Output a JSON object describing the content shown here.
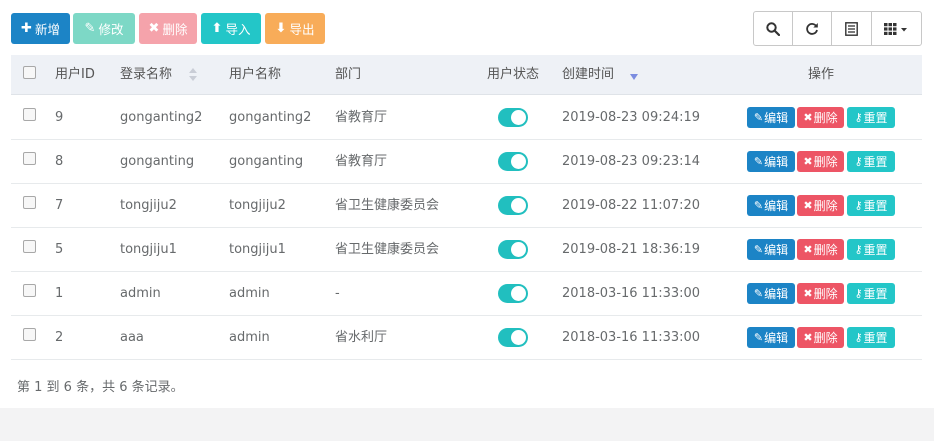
{
  "toolbar": {
    "add_label": "新增",
    "edit_label": "修改",
    "delete_label": "删除",
    "import_label": "导入",
    "export_label": "导出"
  },
  "table": {
    "headers": {
      "user_id": "用户ID",
      "login_name": "登录名称",
      "user_name": "用户名称",
      "dept": "部门",
      "status": "用户状态",
      "create_time": "创建时间",
      "actions": "操作"
    },
    "rows": [
      {
        "id": "9",
        "login": "gonganting2",
        "name": "gonganting2",
        "dept": "省教育厅",
        "created": "2019-08-23 09:24:19"
      },
      {
        "id": "8",
        "login": "gonganting",
        "name": "gonganting",
        "dept": "省教育厅",
        "created": "2019-08-23 09:23:14"
      },
      {
        "id": "7",
        "login": "tongjiju2",
        "name": "tongjiju2",
        "dept": "省卫生健康委员会",
        "created": "2019-08-22 11:07:20"
      },
      {
        "id": "5",
        "login": "tongjiju1",
        "name": "tongjiju1",
        "dept": "省卫生健康委员会",
        "created": "2019-08-21 18:36:19"
      },
      {
        "id": "1",
        "login": "admin",
        "name": "admin",
        "dept": "-",
        "created": "2018-03-16 11:33:00"
      },
      {
        "id": "2",
        "login": "aaa",
        "name": "admin",
        "dept": "省水利厅",
        "created": "2018-03-16 11:33:00"
      }
    ],
    "row_actions": {
      "edit": "编辑",
      "delete": "删除",
      "reset": "重置"
    }
  },
  "pagination": {
    "summary": "第 1 到 6 条，共 6 条记录。"
  },
  "colors": {
    "primary": "#1c84c6",
    "danger": "#ed5565",
    "info": "#23c6c8",
    "warning": "#f8ac59",
    "switch_on": "#21bfbf"
  },
  "icons": [
    "plus-icon",
    "edit-icon",
    "times-icon",
    "upload-icon",
    "download-icon",
    "search-icon",
    "refresh-icon",
    "list-icon",
    "columns-icon",
    "key-icon"
  ]
}
